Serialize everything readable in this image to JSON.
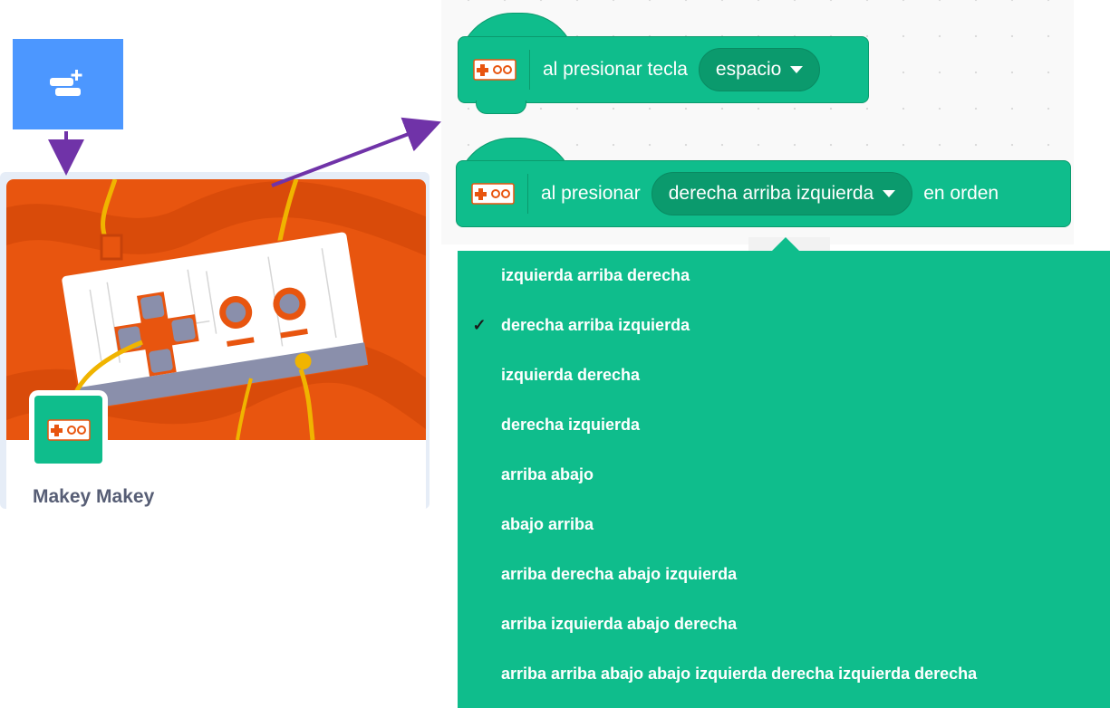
{
  "extension_card": {
    "title": "Makey Makey"
  },
  "blocks": {
    "key_block": {
      "text": "al presionar tecla",
      "dropdown_value": "espacio"
    },
    "sequence_block": {
      "text": "al presionar",
      "dropdown_value": "derecha arriba izquierda",
      "suffix": "en orden"
    }
  },
  "dropdown": {
    "selected_index": 1,
    "check_mark": "✓",
    "options": [
      "izquierda arriba derecha",
      "derecha arriba izquierda",
      "izquierda derecha",
      "derecha izquierda",
      "arriba abajo",
      "abajo arriba",
      "arriba derecha abajo izquierda",
      "arriba izquierda abajo derecha",
      "arriba arriba abajo abajo izquierda derecha izquierda derecha"
    ]
  },
  "colors": {
    "extension_green": "#0fbd8c",
    "extension_button_blue": "#4c97ff",
    "card_hero_orange": "#e8550f",
    "annotation_arrow": "#7033a8"
  },
  "icons": {
    "extension_button": "add-extension-icon",
    "block_icon": "makey-makey-icon"
  }
}
